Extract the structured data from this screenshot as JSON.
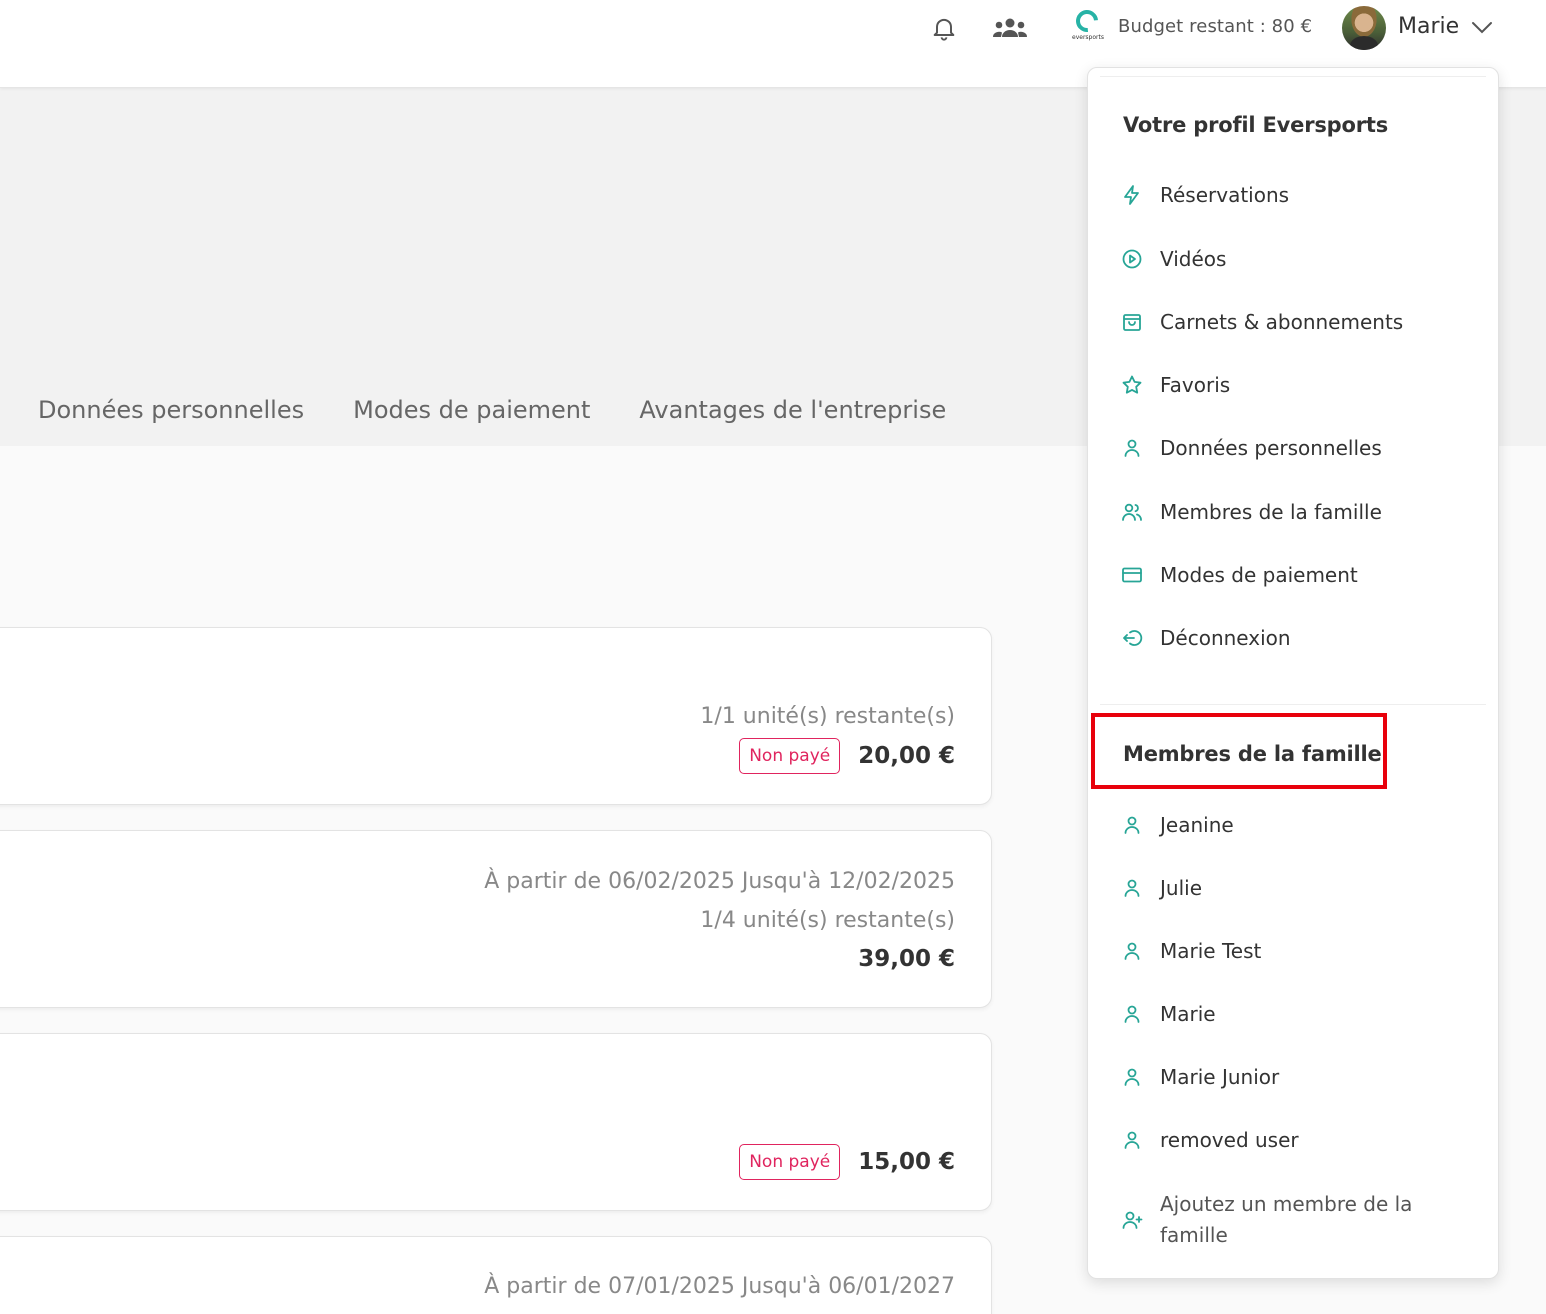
{
  "topbar": {
    "budget": "Budget restant : 80 €",
    "user_name": "Marie",
    "logo_text": "eversports"
  },
  "tabs": [
    "Données personnelles",
    "Modes de paiement",
    "Avantages de l'entreprise"
  ],
  "cards": [
    {
      "lines": [
        "1/1 unité(s) restante(s)"
      ],
      "badge": "Non payé",
      "price": "20,00 €"
    },
    {
      "lines": [
        "À partir de 06/02/2025 Jusqu'à 12/02/2025",
        "1/4 unité(s) restante(s)"
      ],
      "price": "39,00 €"
    },
    {
      "badge": "Non payé",
      "price": "15,00 €"
    },
    {
      "lines": [
        "À partir de 07/01/2025 Jusqu'à 06/01/2027"
      ]
    }
  ],
  "menu": {
    "profile_title": "Votre profil Eversports",
    "items": [
      {
        "label": "Réservations",
        "icon": "bolt-icon"
      },
      {
        "label": "Vidéos",
        "icon": "play-circle-icon"
      },
      {
        "label": "Carnets & abonnements",
        "icon": "shopping-bag-icon"
      },
      {
        "label": "Favoris",
        "icon": "star-icon"
      },
      {
        "label": "Données personnelles",
        "icon": "user-icon"
      },
      {
        "label": "Membres de la famille",
        "icon": "users-icon"
      },
      {
        "label": "Modes de paiement",
        "icon": "credit-card-icon"
      },
      {
        "label": "Déconnexion",
        "icon": "logout-icon"
      }
    ],
    "family_title": "Membres de la famille",
    "family": [
      "Jeanine",
      "Julie",
      "Marie Test",
      "Marie",
      "Marie Junior",
      "removed user"
    ],
    "add_member": "Ajoutez un membre de la famille"
  },
  "colors": {
    "accent": "#27a596",
    "unpaid": "#e0245e",
    "highlight": "#e8000b"
  }
}
